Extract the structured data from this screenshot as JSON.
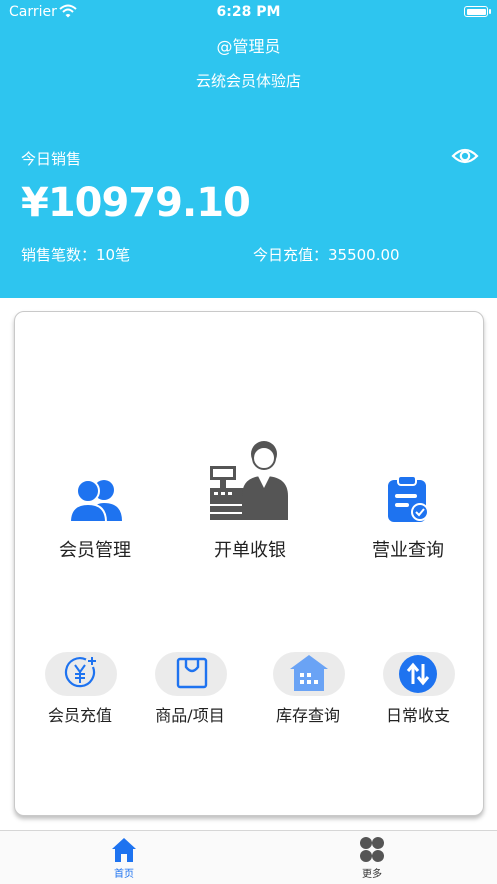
{
  "status_bar": {
    "carrier": "Carrier",
    "time": "6:28 PM"
  },
  "header": {
    "user": "@管理员",
    "store": "云统会员体验店",
    "sales_label": "今日销售",
    "amount": "¥10979.10",
    "sales_count": "销售笔数：10笔",
    "recharge": "今日充值：35500.00"
  },
  "main_actions": [
    {
      "label": "会员管理",
      "icon": "members-icon"
    },
    {
      "label": "开单收银",
      "icon": "cashier-icon"
    },
    {
      "label": "营业查询",
      "icon": "clipboard-icon"
    }
  ],
  "quick_actions": [
    {
      "label": "会员充值",
      "icon": "yuan-plus-icon"
    },
    {
      "label": "商品/项目",
      "icon": "shopping-bag-icon"
    },
    {
      "label": "库存查询",
      "icon": "warehouse-icon"
    },
    {
      "label": "日常收支",
      "icon": "exchange-arrows-icon"
    }
  ],
  "tabbar": {
    "home": "首页",
    "more": "更多"
  },
  "colors": {
    "header_bg": "#2ec5ef",
    "accent_blue": "#1e73f0",
    "icon_dark": "#555555"
  }
}
